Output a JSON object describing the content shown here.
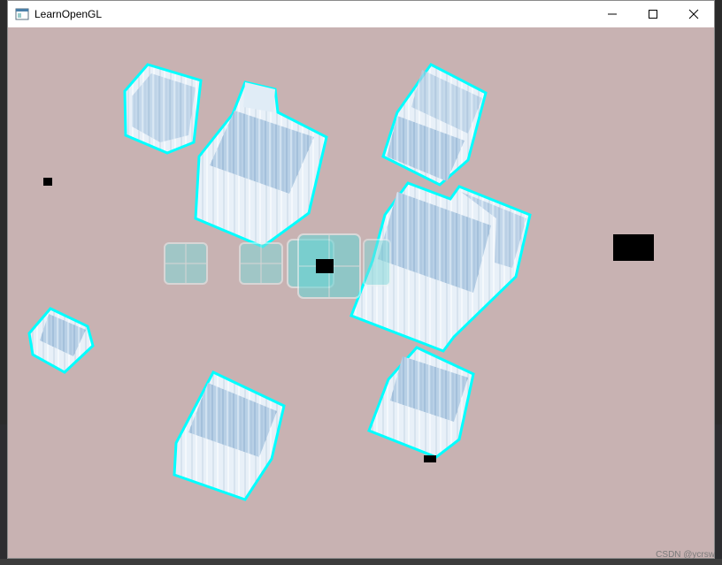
{
  "window": {
    "title": "LearnOpenGL",
    "controls": [
      "minimize-icon",
      "maximize-icon",
      "close-icon"
    ]
  },
  "scene": {
    "background_color": "#c8b2b2",
    "outline_color": "#00ffff",
    "window_quad_color": "#80d8d8"
  },
  "watermark": "CSDN @ycrsw"
}
